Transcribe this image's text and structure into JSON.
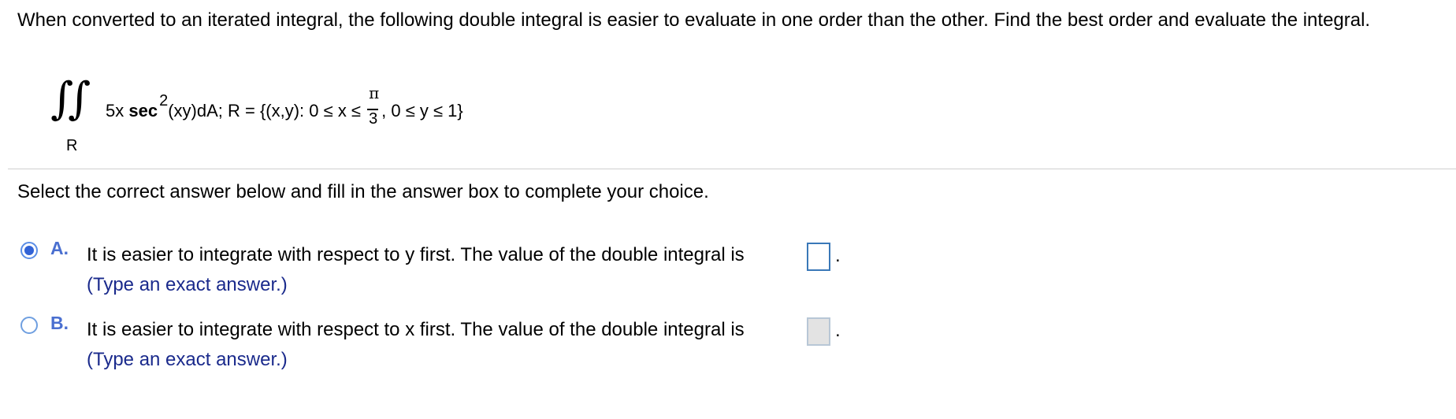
{
  "question": {
    "text": "When converted to an iterated integral, the following double integral is easier to evaluate in one order than the other. Find the best order and evaluate the integral."
  },
  "formula": {
    "integral_symbol": "∫",
    "region_label": "R",
    "coefficient": "5x ",
    "function": "sec",
    "exponent": "2",
    "argument": "(xy)dA; R = {(x,y): 0 ≤ x ≤ ",
    "pi": "π",
    "denominator": "3",
    "tail": ", 0 ≤ y ≤ 1}"
  },
  "instruction": "Select the correct answer below and fill in the answer box to complete your choice.",
  "options": [
    {
      "letter": "A.",
      "text": "It is easier to integrate with respect to y first. The value of the double integral is",
      "hint": "(Type an exact answer.)",
      "selected": true,
      "answer_value": "",
      "period": "."
    },
    {
      "letter": "B.",
      "text": "It is easier to integrate with respect to x first. The value of the double integral is",
      "hint": "(Type an exact answer.)",
      "selected": false,
      "answer_value": "",
      "period": "."
    }
  ],
  "colors": {
    "option_letter": "#4a6fd0",
    "hint_text": "#1a2a8c",
    "radio_selected": "#3263d6",
    "active_box_border": "#3a78b8",
    "inactive_box_fill": "#e3e3e3"
  }
}
